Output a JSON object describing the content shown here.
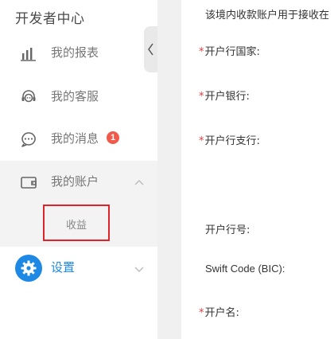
{
  "sidebar": {
    "title": "开发者中心",
    "items": [
      {
        "label": "我的报表",
        "icon": "bar-chart-icon"
      },
      {
        "label": "我的客服",
        "icon": "headset-icon"
      },
      {
        "label": "我的消息",
        "icon": "chat-bubble-icon",
        "badge": "1"
      },
      {
        "label": "我的账户",
        "icon": "wallet-icon",
        "expanded": true
      },
      {
        "label": "设置",
        "icon": "gear-icon",
        "expanded": false
      }
    ],
    "account_sub_items": [
      {
        "label": "收益"
      }
    ]
  },
  "form": {
    "notice": "该境内收款账户用于接收在",
    "fields": [
      {
        "label": "开户行国家:",
        "required": true
      },
      {
        "label": "开户银行:",
        "required": true
      },
      {
        "label": "开户行支行:",
        "required": true
      },
      {
        "label": "开户行号:",
        "required": false
      },
      {
        "label": "Swift Code (BIC):",
        "required": false
      },
      {
        "label": "开户名:",
        "required": true
      }
    ]
  },
  "colors": {
    "accent": "#1e88e5",
    "badge": "#f15a4a",
    "required_mark": "#e23c3c",
    "highlight_box": "#e0222a",
    "account_bg": "#f3f3f3"
  }
}
